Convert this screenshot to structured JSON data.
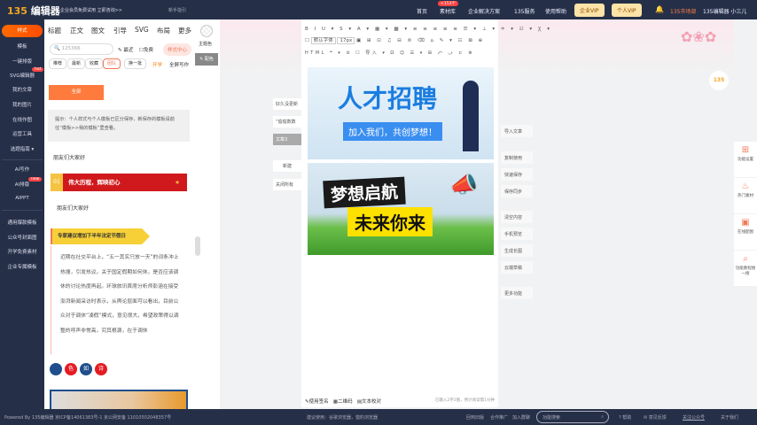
{
  "header": {
    "logo": "135编辑器",
    "logo_num": "135",
    "notice": "企业会员免费试用 立即咨询>>",
    "guide": "新手指引",
    "nav": [
      "首页",
      "素材库",
      "企业解决方案",
      "135服务",
      "使用帮助"
    ],
    "material_badge": "+153个",
    "vip_enterprise": "企业VIP",
    "vip_personal": "个人VIP",
    "market": "135市场部",
    "user": "135编辑器 小三儿"
  },
  "sidebar": {
    "items": [
      "样式",
      "模板",
      "一键排版",
      "SVG编辑器",
      "我的文章",
      "我的图片",
      "在线作图",
      "运营工具",
      "选题指南 ▾",
      "AI写作",
      "AI排版",
      "AIPPT",
      "通用爆款模板",
      "公众号封面图",
      "开学免费素材",
      "企业专属模板"
    ],
    "hot": "hot",
    "new": "new"
  },
  "panel": {
    "tabs": [
      "标题",
      "正文",
      "图文",
      "引导",
      "SVG",
      "布局",
      "更多"
    ],
    "search_value": "125366",
    "recent": "最近",
    "free": "免费",
    "style_center": "样式中心",
    "chips": [
      "推荐",
      "最新",
      "收藏",
      "团队",
      "换一批"
    ],
    "kaixue": "开学",
    "fullscreen": "全屏写作",
    "all_btn": "全部",
    "tip": "提示：个人样式与个人模板已区分保存，新保存的模板请前往“模板>>我的模板”里查看。",
    "greeting1": "朋友们大家好",
    "banner_num": "01",
    "banner_text": "伟大历程，辉映初心",
    "greeting2": "朋友们大家好",
    "section_title": "专家建议增加下半年法定节假日",
    "article": "近期在社交平台上，“五一其实只放一天”的词条冲上热搜，引发热议。关于国定假期如何休，是否应该调休的讨论热度再起。环球旅讯首席分析师彭涵在接受澎湃新闻采访时表示，从舆论层面可以看出，目前公众对于调休“凑假”模式，意见很大，希望政策得以调整的呼声非常高。究其根源，在于调休",
    "chars": [
      "色",
      "如",
      "诗"
    ]
  },
  "strip": {
    "theme_color": "主题色",
    "palette": "配色"
  },
  "editor": {
    "toolbar1": "B I U ▾ S ▾ A ▾ ▦ ▾ ▩ ▾ ≡ ≡ ≡ ≡ ≡ ☰ ▾ ⊥ ▾ ≑ ▾ ☷ ▾ Ꭓ ▾",
    "font": "默认字体",
    "size": "17px",
    "toolbar2": "▣ ⊞ ⊡ ♫ ⊟ ⊜ ⌫ ⌂ ✎ ▾ ☷ ⊠ ⊕",
    "toolbar3": "HTML ❝ ▾ ⊘ ☐ 导入 ▾ Ω ☺ ☰ ▾ ⊞ ⤺ ⤻ ⊏ ⊗",
    "img1_title": "人才招聘",
    "img1_sub": "加入我们，共创梦想！",
    "img2_line1": "梦想启航",
    "img2_line2": "未来你来",
    "signature": "使用签名",
    "qrcode": "二维码",
    "proofread": "文本校对",
    "count": "已输入2字2图，预计阅读需1分钟"
  },
  "left_float": [
    "好久没更新",
    "“偷偷数数",
    "文章3",
    "新建",
    "关闭所有"
  ],
  "right_actions": [
    "导入文章",
    "复制使用",
    "快速保存",
    "保存同步",
    "清空内容",
    "手机预览",
    "生成长图",
    "云端草稿",
    "更多功能"
  ],
  "right_side": [
    "功能设置",
    "热门素材",
    "在线配图",
    "功能教程搜一搜"
  ],
  "footer": {
    "powered": "Powered By 135编辑器  京ICP备14061383号-1 京公网安备 11010502048357号",
    "browser": "建议使用：谷歌浏览器，猎豹浏览器",
    "links": [
      "回到旧版",
      "合作推广",
      "加入群聊"
    ],
    "search_placeholder": "功能搜索",
    "help": "帮助",
    "feedback": "意见反馈",
    "follow": "关注公众号",
    "about": "关于我们"
  }
}
